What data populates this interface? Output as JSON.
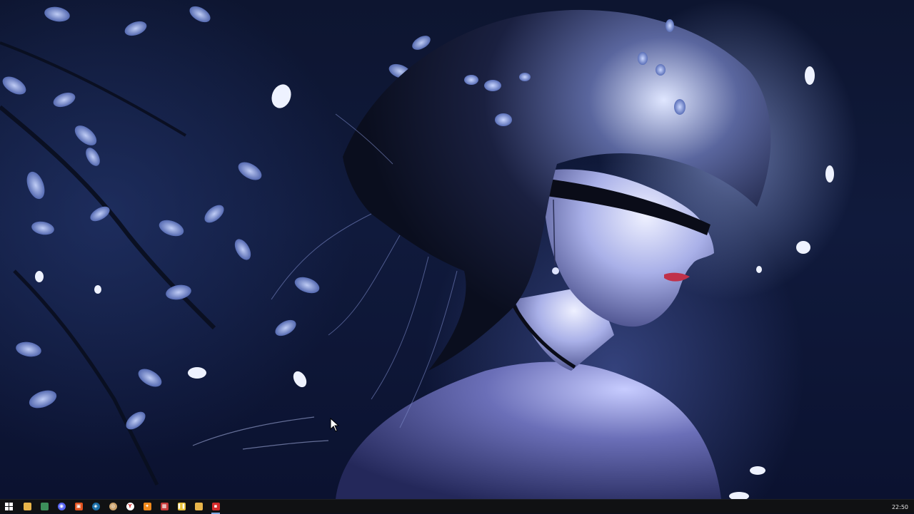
{
  "desktop": {
    "wallpaper_name": "anime-girl-blindfold-blossoms-night"
  },
  "taskbar": {
    "start_icon": "windows-logo-icon",
    "apps": [
      {
        "name": "file-explorer",
        "icon": "folder-icon",
        "color": "#e8b54a",
        "glyph": ""
      },
      {
        "name": "app-generic-green",
        "icon": "calendar-icon",
        "color": "#3d8f5a",
        "glyph": ""
      },
      {
        "name": "discord",
        "icon": "discord-icon",
        "color": "#5865f2",
        "glyph": "◉"
      },
      {
        "name": "app-orange",
        "icon": "app-orange-icon",
        "color": "#e2531f",
        "glyph": "▣"
      },
      {
        "name": "steam",
        "icon": "steam-icon",
        "color": "#1b6fa8",
        "glyph": "◈"
      },
      {
        "name": "app-circle",
        "icon": "circle-app-icon",
        "color": "#c9a06a",
        "glyph": "◎"
      },
      {
        "name": "yandex-browser",
        "icon": "yandex-icon",
        "color": "#ffffff",
        "glyph": "Y"
      },
      {
        "name": "app-fox",
        "icon": "fox-icon",
        "color": "#f08a1c",
        "glyph": "✦"
      },
      {
        "name": "app-multicolor",
        "icon": "tile-app-icon",
        "color": "#c63b3b",
        "glyph": "▦"
      },
      {
        "name": "app-bars",
        "icon": "bars-icon",
        "color": "#e8c23a",
        "glyph": "❚❚"
      },
      {
        "name": "app-document",
        "icon": "document-icon",
        "color": "#e8b54a",
        "glyph": ""
      },
      {
        "name": "app-red",
        "icon": "red-app-icon",
        "color": "#d42b2b",
        "glyph": "▪"
      }
    ],
    "clock": "22:50"
  }
}
